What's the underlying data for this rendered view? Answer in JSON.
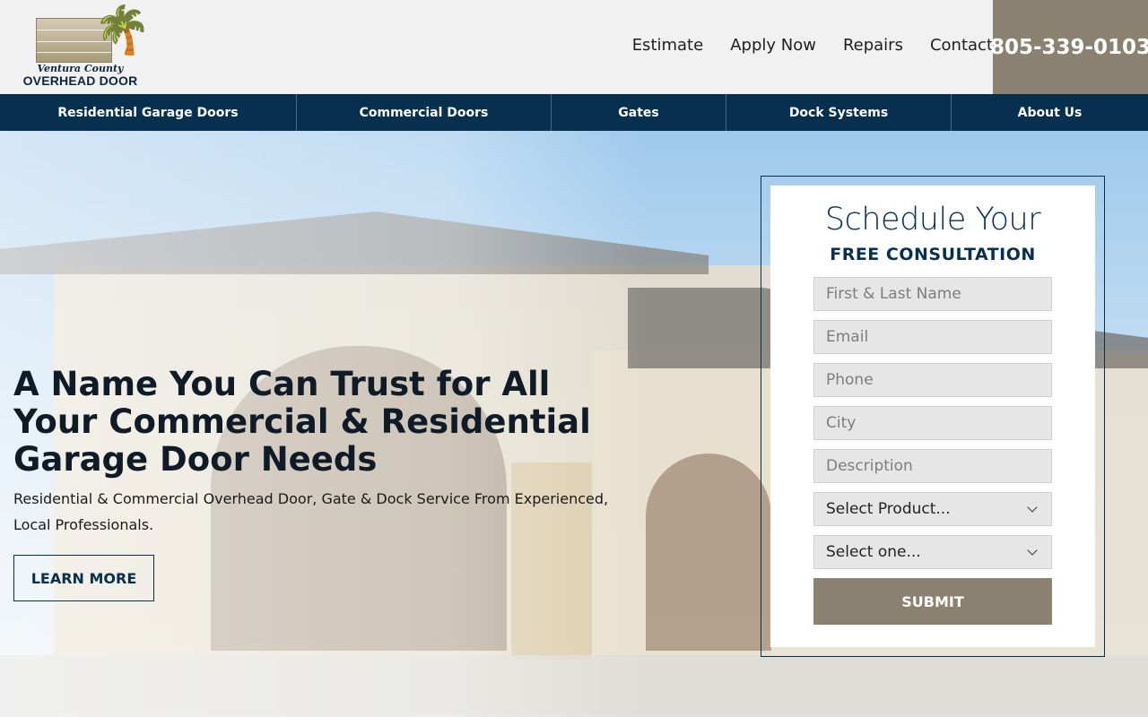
{
  "logo": {
    "line1": "Ventura County",
    "line2": "OVERHEAD DOOR",
    "palm_icon": "palm-tree-icon"
  },
  "topnav": [
    "Estimate",
    "Apply Now",
    "Repairs",
    "Contact"
  ],
  "phone": "805-339-0103",
  "mainnav": [
    "Residential Garage Doors",
    "Commercial Doors",
    "Gates",
    "Dock Systems",
    "About Us"
  ],
  "hero": {
    "headline": "A Name You Can Trust for All Your Commercial & Residential Garage Door Needs",
    "subline": "Residential & Commercial Overhead Door, Gate & Dock Service From Experienced, Local Professionals.",
    "cta": "LEARN MORE"
  },
  "form": {
    "title": "Schedule Your",
    "subtitle": "FREE CONSULTATION",
    "placeholders": {
      "name": "First & Last Name",
      "email": "Email",
      "phone": "Phone",
      "city": "City",
      "description": "Description"
    },
    "product_select": "Select Product...",
    "type_select": "Select one...",
    "submit": "SUBMIT"
  },
  "colors": {
    "navy": "#07304f",
    "taupe": "#8a8170",
    "header_bg": "#f1f1f1"
  }
}
